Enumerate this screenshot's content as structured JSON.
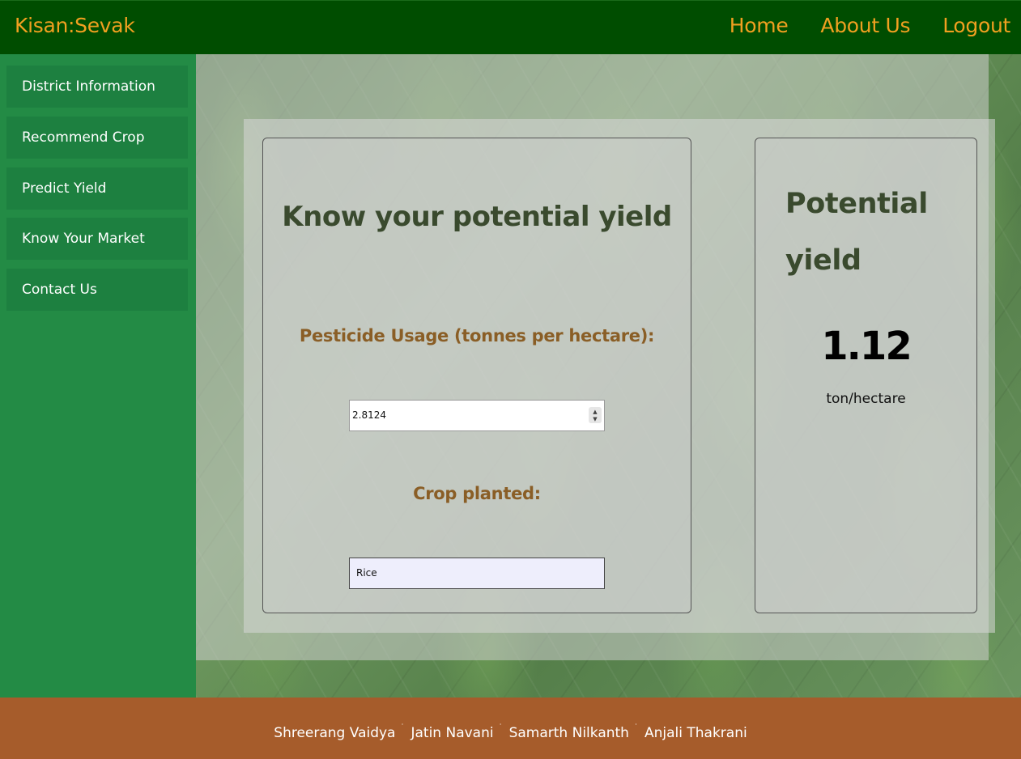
{
  "header": {
    "brand": "Kisan:Sevak",
    "nav": [
      "Home",
      "About Us",
      "Logout"
    ]
  },
  "sidebar": {
    "items": [
      "District Information",
      "Recommend Crop",
      "Predict Yield",
      "Know Your Market",
      "Contact Us"
    ]
  },
  "form": {
    "heading": "Know your potential yield",
    "pesticide_label": "Pesticide Usage (tonnes per hectare):",
    "pesticide_value": "2.8124",
    "crop_label": "Crop planted:",
    "crop_value": "Rice"
  },
  "result": {
    "title": "Potential yield",
    "value": "1.12",
    "unit": "ton/hectare"
  },
  "footer": {
    "names": [
      "Shreerang Vaidya",
      "Jatin Navani",
      "Samarth Nilkanth",
      "Anjali Thakrani"
    ],
    "separator": "˙"
  },
  "icons": {
    "spinner_up": "chevron-up-icon",
    "spinner_down": "chevron-down-icon"
  },
  "colors": {
    "topbar": "#004d00",
    "brand_text": "#f0a020",
    "sidebar": "#238b45",
    "footer": "#a65c2b",
    "heading": "#3a4a2e",
    "label": "#8a5e26"
  }
}
